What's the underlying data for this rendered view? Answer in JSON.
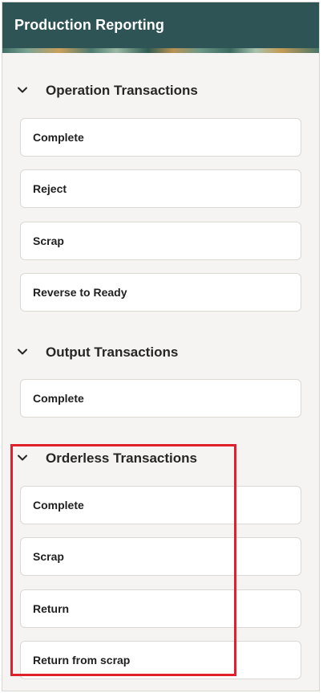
{
  "header": {
    "title": "Production Reporting"
  },
  "sections": [
    {
      "title": "Operation Transactions",
      "items": [
        "Complete",
        "Reject",
        "Scrap",
        "Reverse to Ready"
      ]
    },
    {
      "title": "Output Transactions",
      "items": [
        "Complete"
      ]
    },
    {
      "title": "Orderless Transactions",
      "items": [
        "Complete",
        "Scrap",
        "Return",
        "Return from scrap"
      ]
    }
  ],
  "colors": {
    "header_bg": "#2f5455",
    "panel_bg": "#f5f4f2",
    "highlight": "#e0202a"
  }
}
